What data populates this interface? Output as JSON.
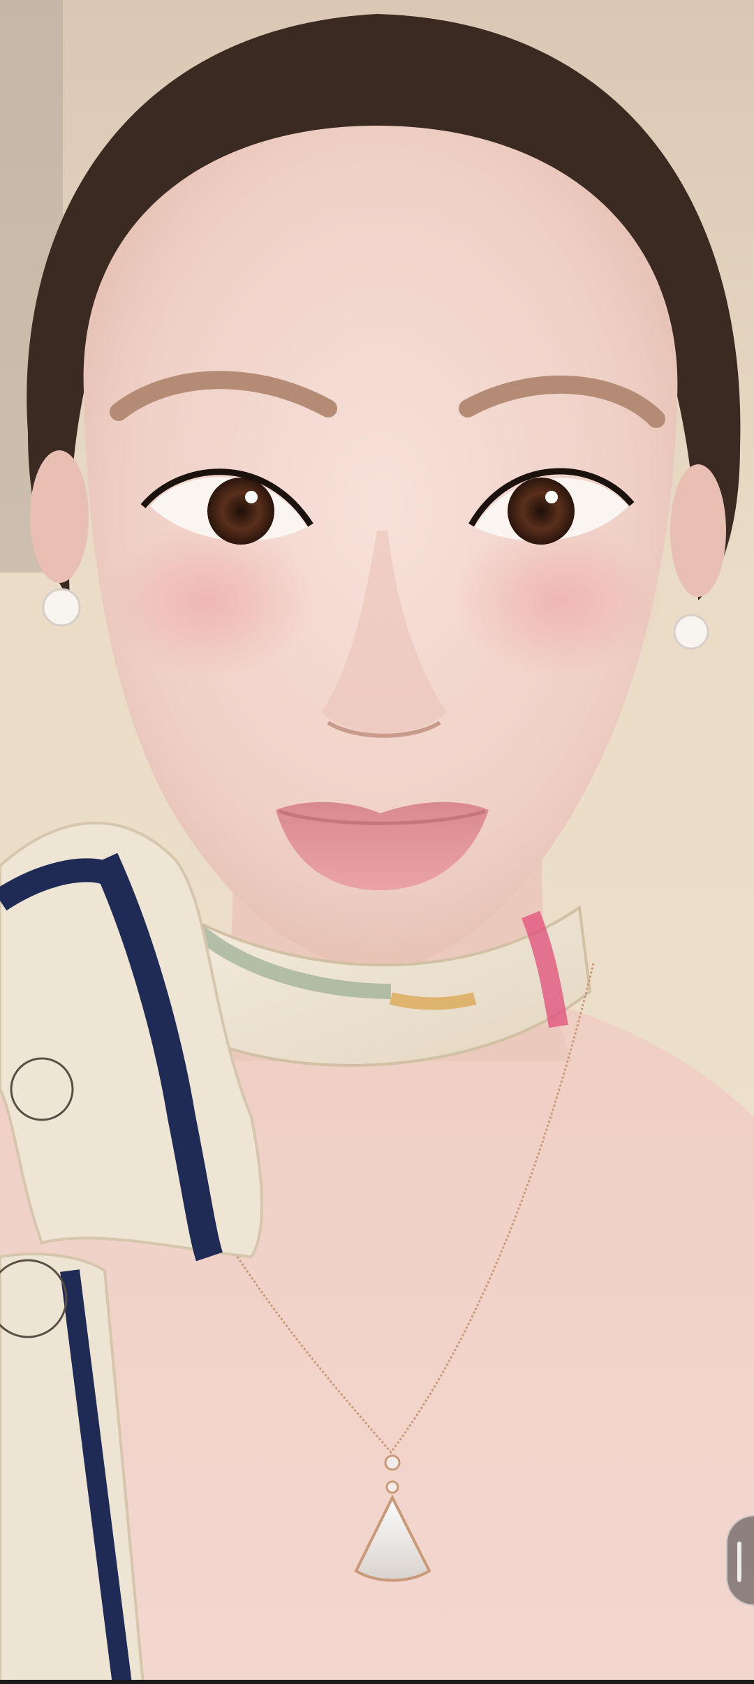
{
  "scene": {
    "subject": "portrait-selfie",
    "background_color": "#e9dcc9",
    "skin_color": "#f1d5cd",
    "hair_color": "#3a2a22",
    "scarf_base_color": "#efe6d6",
    "scarf_stripe_color": "#1f2a55",
    "necklace_color": "#c99a7a",
    "lip_color": "#e79a9c"
  },
  "overlay": {
    "edge_control": "side-handle-icon"
  }
}
